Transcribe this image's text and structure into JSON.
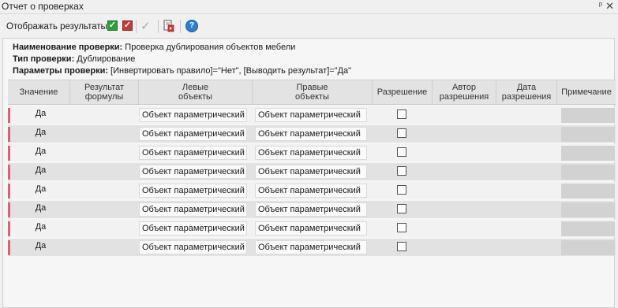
{
  "window": {
    "title": "Отчет о проверках",
    "pin_glyph": "ᵖ",
    "close_glyph": "✕"
  },
  "toolbar": {
    "show_results_label": "Отображать результаты:",
    "icons": {
      "green_check": "checkbox-green-check-icon",
      "red_check": "checkbox-red-check-icon",
      "approve": "checkmark-icon",
      "export": "export-document-icon",
      "help": "help-icon"
    },
    "help_glyph": "?",
    "check_glyph": "✓",
    "approve_glyph": "✓"
  },
  "info": {
    "name_label": "Наименование проверки:",
    "name_value": " Проверка дублирования объектов мебели",
    "type_label": "Тип проверки:",
    "type_value": " Дублирование",
    "params_label": "Параметры проверки:",
    "params_value": " [Инвертировать правило]=\"Нет\", [Выводить результат]=\"Да\""
  },
  "table": {
    "columns": [
      "Значение",
      "Результат\nформулы",
      "Левые\nобъекты",
      "Правые\nобъекты",
      "Разрешение",
      "Автор\nразрешения",
      "Дата\nразрешения",
      "Примечание"
    ],
    "rows": [
      {
        "value": "Да",
        "formula": "",
        "left": "Объект параметрический",
        "right": "Объект параметрический",
        "resolved": false,
        "author": "",
        "date": "",
        "note": ""
      },
      {
        "value": "Да",
        "formula": "",
        "left": "Объект параметрический",
        "right": "Объект параметрический",
        "resolved": false,
        "author": "",
        "date": "",
        "note": ""
      },
      {
        "value": "Да",
        "formula": "",
        "left": "Объект параметрический",
        "right": "Объект параметрический",
        "resolved": false,
        "author": "",
        "date": "",
        "note": ""
      },
      {
        "value": "Да",
        "formula": "",
        "left": "Объект параметрический",
        "right": "Объект параметрический",
        "resolved": false,
        "author": "",
        "date": "",
        "note": ""
      },
      {
        "value": "Да",
        "formula": "",
        "left": "Объект параметрический",
        "right": "Объект параметрический",
        "resolved": false,
        "author": "",
        "date": "",
        "note": ""
      },
      {
        "value": "Да",
        "formula": "",
        "left": "Объект параметрический",
        "right": "Объект параметрический",
        "resolved": false,
        "author": "",
        "date": "",
        "note": ""
      },
      {
        "value": "Да",
        "formula": "",
        "left": "Объект параметрический",
        "right": "Объект параметрический",
        "resolved": false,
        "author": "",
        "date": "",
        "note": ""
      },
      {
        "value": "Да",
        "formula": "",
        "left": "Объект параметрический",
        "right": "Объект параметрический",
        "resolved": false,
        "author": "",
        "date": "",
        "note": ""
      }
    ]
  },
  "colors": {
    "row_marker": "#e06070",
    "green_checkbox": "#2e9f3a",
    "red_checkbox": "#c63a3a",
    "help_blue": "#2a7fd4"
  }
}
